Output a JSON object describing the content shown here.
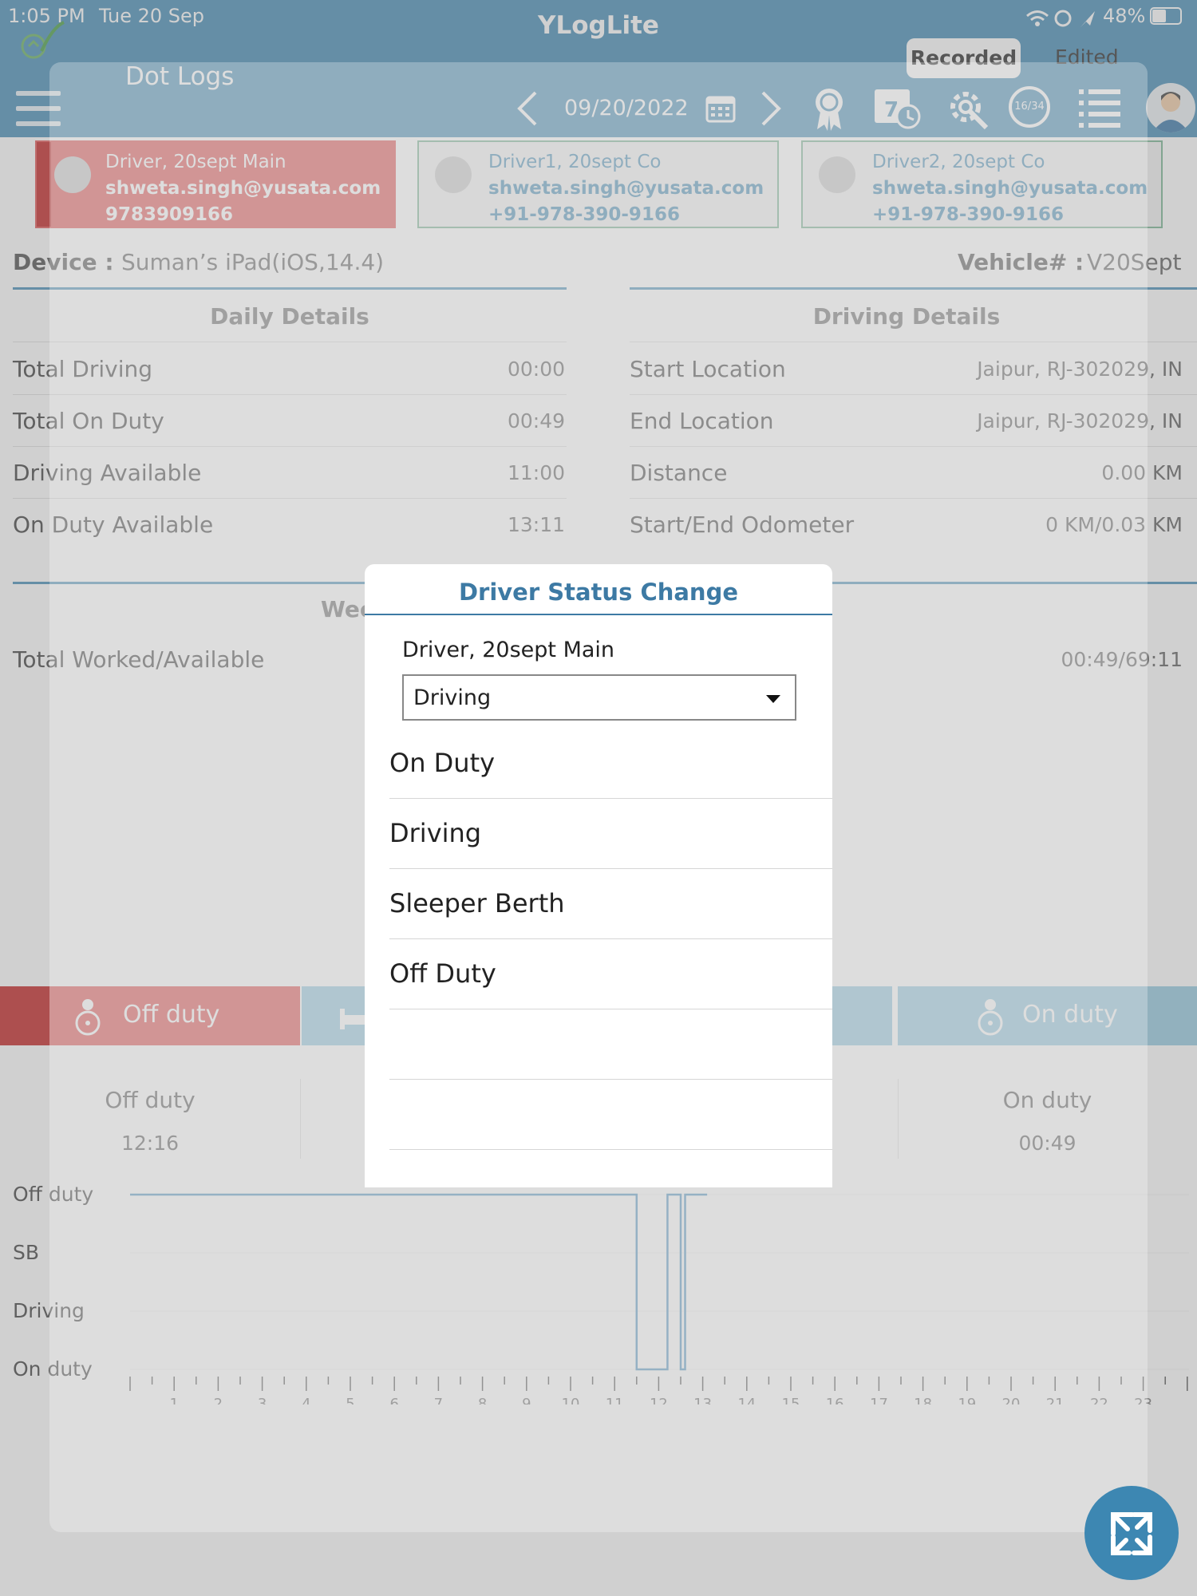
{
  "status_bar": {
    "time": "1:05 PM",
    "date": "Tue 20 Sep",
    "battery": "48%"
  },
  "app": {
    "title": "YLogLite",
    "page_title": "Dot Logs"
  },
  "toggle": {
    "recorded": "Recorded",
    "edited": "Edited"
  },
  "nav": {
    "date": "09/20/2022",
    "cycle_badge": "16/34"
  },
  "drivers": [
    {
      "name": "Driver, 20sept Main",
      "email": "shweta.singh@yusata.com",
      "phone": "9783909166"
    },
    {
      "name": "Driver1, 20sept Co",
      "email": "shweta.singh@yusata.com",
      "phone": "+91-978-390-9166"
    },
    {
      "name": "Driver2, 20sept Co",
      "email": "shweta.singh@yusata.com",
      "phone": "+91-978-390-9166"
    }
  ],
  "device": {
    "label": "Device :",
    "value": "Suman’s iPad(iOS,14.4)"
  },
  "vehicle": {
    "label": "Vehicle# :",
    "value": "V20Sept"
  },
  "daily": {
    "header": "Daily Details",
    "rows": [
      {
        "label": "Total Driving",
        "value": "00:00"
      },
      {
        "label": "Total On Duty",
        "value": "00:49"
      },
      {
        "label": "Driving Available",
        "value": "11:00"
      },
      {
        "label": "On Duty Available",
        "value": "13:11"
      }
    ]
  },
  "driving": {
    "header": "Driving Details",
    "rows": [
      {
        "label": "Start Location",
        "value": "Jaipur, RJ-302029, IN"
      },
      {
        "label": "End Location",
        "value": "Jaipur, RJ-302029, IN"
      },
      {
        "label": "Distance",
        "value": "0.00 KM"
      },
      {
        "label": "Start/End Odometer",
        "value": "0 KM/0.03 KM"
      }
    ]
  },
  "weekly": {
    "header_partial": "Wee",
    "label": "Total Worked/Available",
    "value": "00:49/69:11"
  },
  "status_tabs": {
    "off_duty": "Off duty",
    "on_duty": "On duty"
  },
  "summary": {
    "off_duty": {
      "label": "Off duty",
      "value": "12:16"
    },
    "on_duty": {
      "label": "On duty",
      "value": "00:49"
    }
  },
  "chart_data": {
    "type": "line",
    "rows": [
      "Off duty",
      "SB",
      "Driving",
      "On duty"
    ],
    "x_ticks": [
      "1",
      "2",
      "3",
      "4",
      "5",
      "6",
      "7",
      "8",
      "9",
      "10",
      "11",
      "12",
      "13",
      "14",
      "15",
      "16",
      "17",
      "18",
      "19",
      "20",
      "21",
      "22",
      "23"
    ],
    "steps": [
      {
        "from": 0.0,
        "to": 11.5,
        "status": "Off duty"
      },
      {
        "from": 11.5,
        "to": 12.2,
        "status": "On duty"
      },
      {
        "from": 12.2,
        "to": 12.5,
        "status": "Off duty"
      },
      {
        "from": 12.5,
        "to": 12.6,
        "status": "On duty"
      },
      {
        "from": 12.6,
        "to": 13.1,
        "status": "Off duty"
      }
    ]
  },
  "modal": {
    "title": "Driver Status Change",
    "driver": "Driver, 20sept Main",
    "selected": "Driving",
    "options": [
      "On Duty",
      "Driving",
      "Sleeper Berth",
      "Off Duty"
    ]
  },
  "colors": {
    "primary": "#3d87b2",
    "active_red": "#e04b4b",
    "stripe_red": "#c01515"
  }
}
